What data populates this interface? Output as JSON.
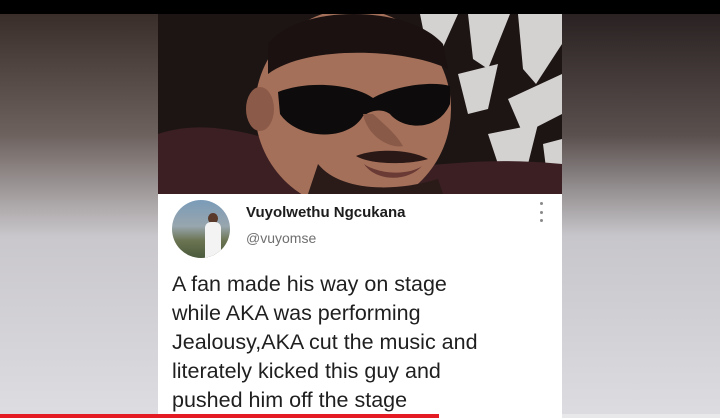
{
  "post": {
    "author_name": "Vuyolwethu Ngcukana",
    "author_handle": "@vuyomse",
    "text_lines": [
      "A fan made his way on stage",
      "while AKA was performing",
      "Jealousy,AKA cut the music and",
      "literately kicked this guy and",
      "pushed him off the stage"
    ]
  },
  "icons": {
    "menu": "more-vertical-icon",
    "avatar": "profile-avatar"
  },
  "video": {
    "progress": 0.61
  },
  "colors": {
    "progress": "#e41b23",
    "card_bg": "#ffffff",
    "name_text": "#1c1c1c",
    "handle_text": "#6f6f6f"
  }
}
